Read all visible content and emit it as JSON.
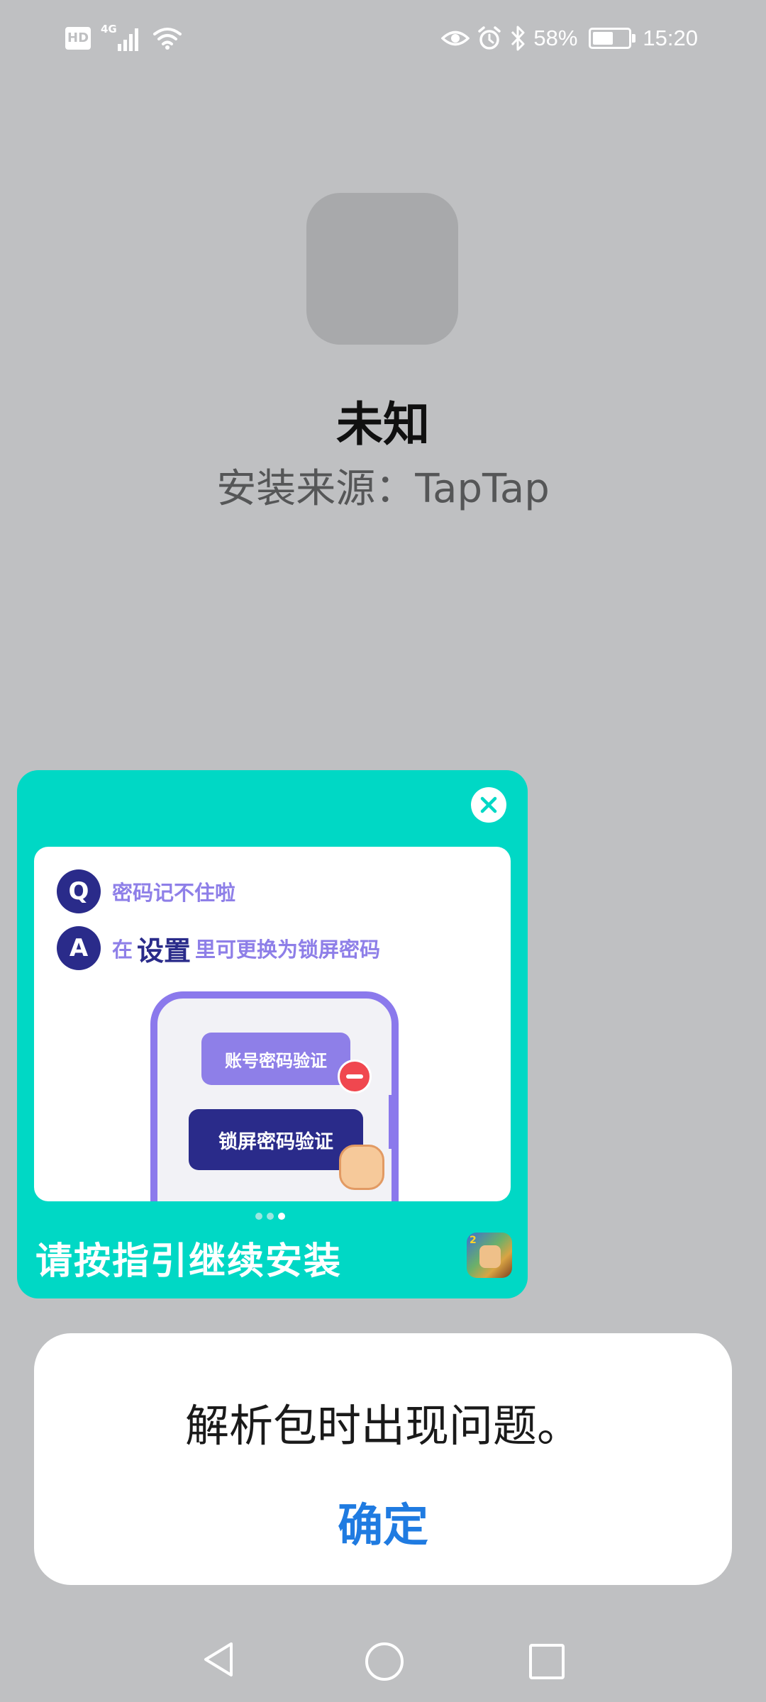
{
  "status_bar": {
    "hd_label": "HD",
    "network_label": "4G",
    "battery_percent": "58%",
    "battery_level": 0.58,
    "time": "15:20",
    "icons": [
      "hd-icon",
      "signal-icon",
      "wifi-icon",
      "eye-icon",
      "alarm-icon",
      "bluetooth-icon",
      "battery-charging-icon"
    ]
  },
  "app": {
    "name": "未知",
    "install_source": "安装来源：TapTap"
  },
  "ad": {
    "q_badge": "Q",
    "question": "密码记不住啦",
    "a_badge": "A",
    "answer_prefix": "在",
    "answer_emphasis": "设置",
    "answer_suffix": "里可更换为锁屏密码",
    "option_account": "账号密码验证",
    "option_lock": "锁屏密码验证",
    "cta": "请按指引继续安装",
    "game_badge": "2",
    "pager_count": 3,
    "pager_active": 3
  },
  "dialog": {
    "message": "解析包时出现问题。",
    "confirm_label": "确定"
  },
  "nav_bar": {
    "icons": [
      "back-icon",
      "home-icon",
      "recents-icon"
    ]
  },
  "colors": {
    "background": "#bfc0c2",
    "ad_accent": "#00d8c5",
    "ad_purple": "#8e7fe8",
    "ad_navy": "#2a2b8a",
    "confirm_blue": "#1f7be1"
  }
}
